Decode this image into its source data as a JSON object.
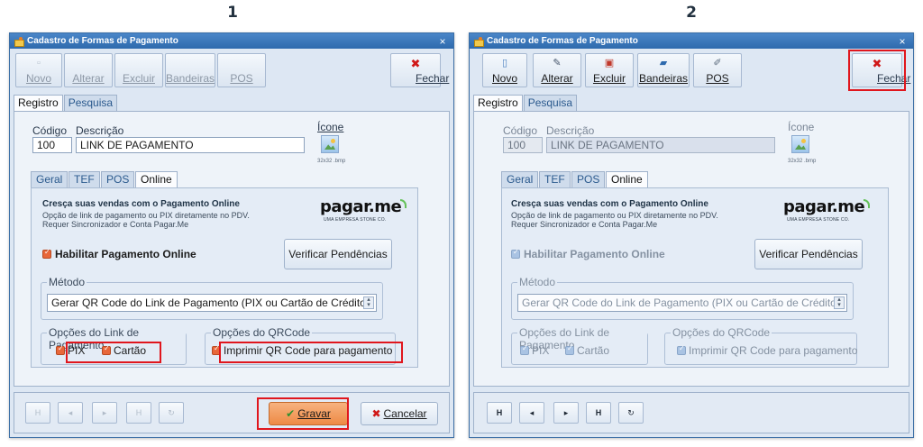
{
  "steps": [
    "1",
    "2"
  ],
  "window": {
    "title": "Cadastro de Formas de Pagamento",
    "close_glyph": "×"
  },
  "toolbar": {
    "novo": "Novo",
    "alterar": "Alterar",
    "excluir": "Excluir",
    "bandeiras": "Bandeiras",
    "pos": "POS",
    "fechar": "Fechar"
  },
  "tabs": [
    "Registro",
    "Pesquisa"
  ],
  "form": {
    "codigo_label": "Código",
    "descricao_label": "Descrição",
    "icone_label": "Ícone",
    "codigo_value": "100",
    "descricao_value": "LINK DE PAGAMENTO",
    "icone_size": "32x32 .bmp"
  },
  "inner_tabs": [
    "Geral",
    "TEF",
    "POS",
    "Online"
  ],
  "online": {
    "promo_title": "Cresça suas vendas com o Pagamento Online",
    "promo_line1": "Opção de link de pagamento ou PIX diretamente no PDV.",
    "promo_line2": "Requer Sincronizador e Conta Pagar.Me",
    "logo": "pagar.me",
    "logo_sub": "UMA EMPRESA STONE CO.",
    "habilitar_label": "Habilitar Pagamento Online",
    "verificar_button": "Verificar Pendências",
    "metodo_label": "Método",
    "metodo_value": "Gerar QR Code do Link de Pagamento (PIX ou Cartão de Crédito)",
    "opcoes_link_label": "Opções do Link de Pagamento",
    "pix_label": "PIX",
    "cartao_label": "Cartão",
    "opcoes_qr_label": "Opções do QRCode",
    "imprimir_label": "Imprimir QR Code para pagamento"
  },
  "nav": {
    "first": "H",
    "prev": "◂",
    "next": "▸",
    "last": "H",
    "refresh": "↻"
  },
  "actions": {
    "gravar": "Gravar",
    "cancelar": "Cancelar"
  },
  "colors": {
    "highlight": "#e0161d",
    "accent_orange": "#ee8a45",
    "title_bar": "#2e6aad",
    "logo_green": "#65c15a"
  }
}
